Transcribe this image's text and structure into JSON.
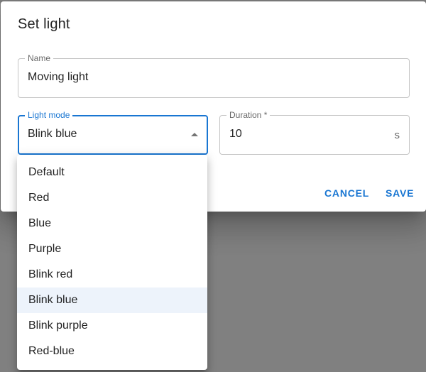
{
  "dialog": {
    "title": "Set light",
    "name_field": {
      "label": "Name",
      "value": "Moving light"
    },
    "mode_field": {
      "label": "Light mode",
      "value": "Blink blue"
    },
    "duration_field": {
      "label": "Duration *",
      "value": "10",
      "unit": "s"
    },
    "actions": {
      "cancel_label": "CANCEL",
      "save_label": "SAVE"
    }
  },
  "menu": {
    "items": [
      {
        "label": "Default"
      },
      {
        "label": "Red"
      },
      {
        "label": "Blue"
      },
      {
        "label": "Purple"
      },
      {
        "label": "Blink red"
      },
      {
        "label": "Blink blue"
      },
      {
        "label": "Blink purple"
      },
      {
        "label": "Red-blue"
      }
    ],
    "selected_label": "Blink blue"
  },
  "colors": {
    "primary": "#1976d2",
    "backdrop": "#808080",
    "selected_bg": "#edf3fb"
  }
}
